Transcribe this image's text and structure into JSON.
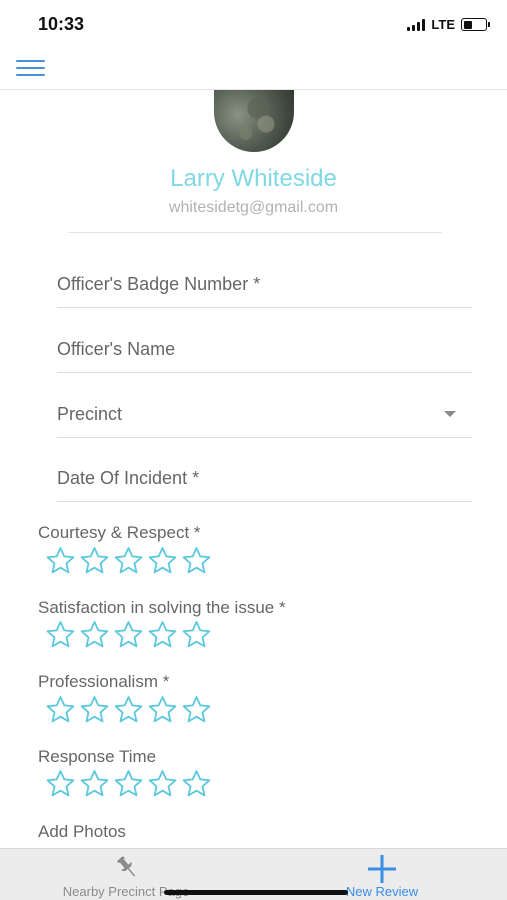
{
  "status_bar": {
    "time": "10:33",
    "network": "LTE"
  },
  "profile": {
    "name": "Larry Whiteside",
    "email": "whitesidetg@gmail.com"
  },
  "form": {
    "badge_placeholder": "Officer's Badge Number *",
    "name_placeholder": "Officer's Name",
    "precinct_placeholder": "Precinct",
    "date_placeholder": "Date Of Incident *"
  },
  "ratings": [
    {
      "label": "Courtesy & Respect *",
      "value": 0,
      "max": 5
    },
    {
      "label": "Satisfaction in solving the issue *",
      "value": 0,
      "max": 5
    },
    {
      "label": "Professionalism *",
      "value": 0,
      "max": 5
    },
    {
      "label": "Response Time",
      "value": 0,
      "max": 5
    }
  ],
  "photos_label": "Add Photos",
  "tabs": {
    "nearby": {
      "label": "Nearby Precinct Page",
      "icon": "pushpin-icon"
    },
    "new_review": {
      "label": "New Review",
      "icon": "plus-icon"
    }
  },
  "colors": {
    "accent": "#4a90d9",
    "name_text": "#7fd8e6",
    "star_outline": "#5bc8dd",
    "tab_active": "#3a8ee6"
  }
}
